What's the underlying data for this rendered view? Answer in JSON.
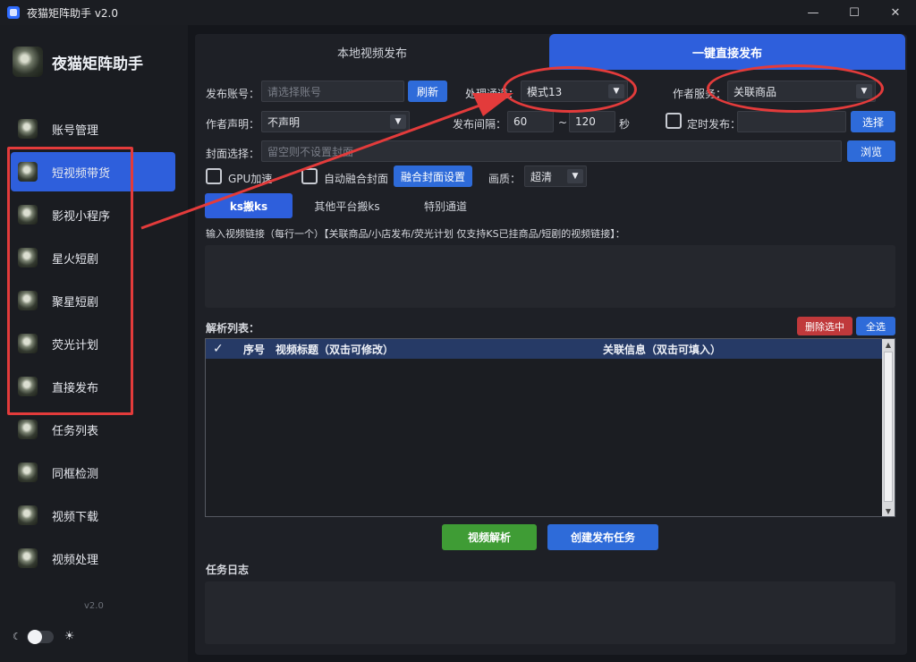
{
  "window": {
    "title": "夜猫矩阵助手 v2.0",
    "minimize": "—",
    "maximize": "☐",
    "close": "✕"
  },
  "sidebar": {
    "brand": "夜猫矩阵助手",
    "items": [
      {
        "label": "账号管理"
      },
      {
        "label": "短视频带货"
      },
      {
        "label": "影视小程序"
      },
      {
        "label": "星火短剧"
      },
      {
        "label": "聚星短剧"
      },
      {
        "label": "荧光计划"
      },
      {
        "label": "直接发布"
      },
      {
        "label": "任务列表"
      },
      {
        "label": "同框检测"
      },
      {
        "label": "视频下载"
      },
      {
        "label": "视频处理"
      }
    ],
    "active_index": 1,
    "version": "v2.0",
    "theme_moon": "☾",
    "theme_sun": "☀"
  },
  "tabs": {
    "local": "本地视频发布",
    "direct": "一键直接发布"
  },
  "form": {
    "account_label": "发布账号：",
    "account_placeholder": "请选择账号",
    "refresh": "刷新",
    "channel_label": "处理通道：",
    "channel_value": "模式13",
    "author_service_label": "作者服务：",
    "author_service_value": "关联商品",
    "author_statement_label": "作者声明：",
    "author_statement_value": "不声明",
    "interval_label": "发布间隔：",
    "interval_min": "60",
    "interval_sep": "~",
    "interval_max": "120",
    "interval_unit": "秒",
    "schedule_label": "定时发布：",
    "schedule_button": "选择",
    "cover_label": "封面选择：",
    "cover_placeholder": "留空则不设置封面",
    "browse": "浏览",
    "gpu_label": "GPU加速",
    "auto_cover_label": "自动融合封面",
    "cover_settings": "融合封面设置",
    "quality_label": "画质：",
    "quality_value": "超清"
  },
  "sub_tabs": [
    "ks搬ks",
    "其他平台搬ks",
    "特别通道"
  ],
  "link_prompt": "输入视频链接（每行一个）【关联商品/小店发布/荧光计划 仅支持KS已挂商品/短剧的视频链接】：",
  "parse_list": {
    "title": "解析列表：",
    "delete_selected": "删除选中",
    "select_all": "全选",
    "col_check": "✓",
    "col_index": "序号",
    "col_title": "视频标题（双击可修改）",
    "col_info": "关联信息（双击可填入）"
  },
  "actions": {
    "parse": "视频解析",
    "create_task": "创建发布任务"
  },
  "log": {
    "title": "任务日志"
  },
  "colors": {
    "accent": "#2e5fdc",
    "annotation": "#e33b3b",
    "green": "#3f9c35",
    "danger": "#c0393b"
  }
}
